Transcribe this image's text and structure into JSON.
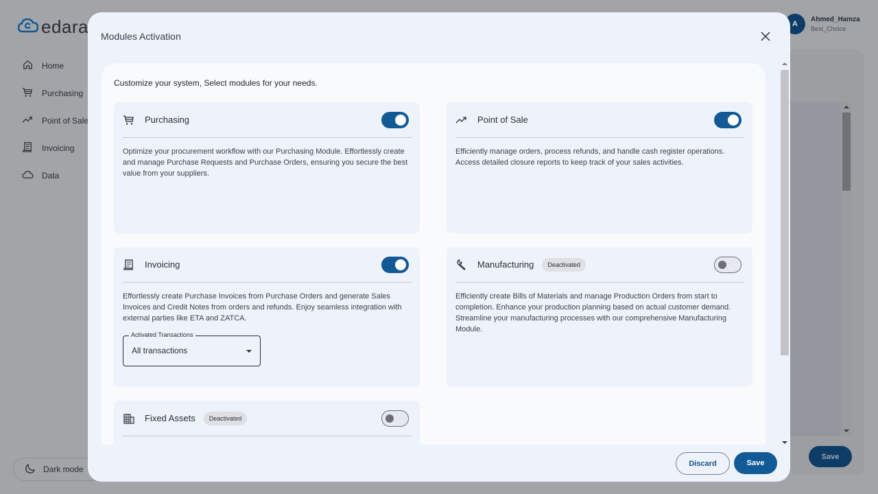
{
  "app": {
    "logo_text": "edara",
    "brand_color": "#115a96",
    "sidebar": {
      "items": [
        {
          "label": "Home",
          "icon": "home-icon"
        },
        {
          "label": "Purchasing",
          "icon": "cart-icon"
        },
        {
          "label": "Point of Sale",
          "icon": "trending-up-icon"
        },
        {
          "label": "Invoicing",
          "icon": "receipt-icon"
        },
        {
          "label": "Data",
          "icon": "cloud-icon"
        }
      ],
      "dark_mode_label": "Dark mode"
    },
    "user": {
      "avatar_initial": "A",
      "name": "Ahmed_Hamza",
      "company": "Best_Choice"
    },
    "background_save_label": "Save"
  },
  "modal": {
    "title": "Modules Activation",
    "intro": "Customize your system, Select modules for your needs.",
    "modules": [
      {
        "name": "Purchasing",
        "icon": "cart-icon",
        "active": true,
        "badge": null,
        "description": "Optimize your procurement workflow with our Purchasing Module. Effortlessly create and manage Purchase Requests and Purchase Orders, ensuring you secure the best value from your suppliers."
      },
      {
        "name": "Point of Sale",
        "icon": "trending-up-icon",
        "active": true,
        "badge": null,
        "description": "Efficiently manage orders, process refunds, and handle cash register operations. Access detailed closure reports to keep track of your sales activities."
      },
      {
        "name": "Invoicing",
        "icon": "receipt-icon",
        "active": true,
        "badge": null,
        "description": "Effortlessly create Purchase Invoices from Purchase Orders and generate Sales Invoices and Credit Notes from orders and refunds. Enjoy seamless integration with external parties like ETA and ZATCA.",
        "select": {
          "label": "Activated Transactions",
          "value": "All transactions"
        }
      },
      {
        "name": "Manufacturing",
        "icon": "wrench-icon",
        "active": false,
        "badge": "Deactivated",
        "description": "Efficiently create Bills of Materials and manage Production Orders from start to completion. Enhance your production planning based on actual customer demand. Streamline your manufacturing processes with our comprehensive Manufacturing Module."
      },
      {
        "name": "Fixed Assets",
        "icon": "building-icon",
        "active": false,
        "badge": "Deactivated",
        "description": ""
      }
    ],
    "discard_label": "Discard",
    "save_label": "Save"
  }
}
